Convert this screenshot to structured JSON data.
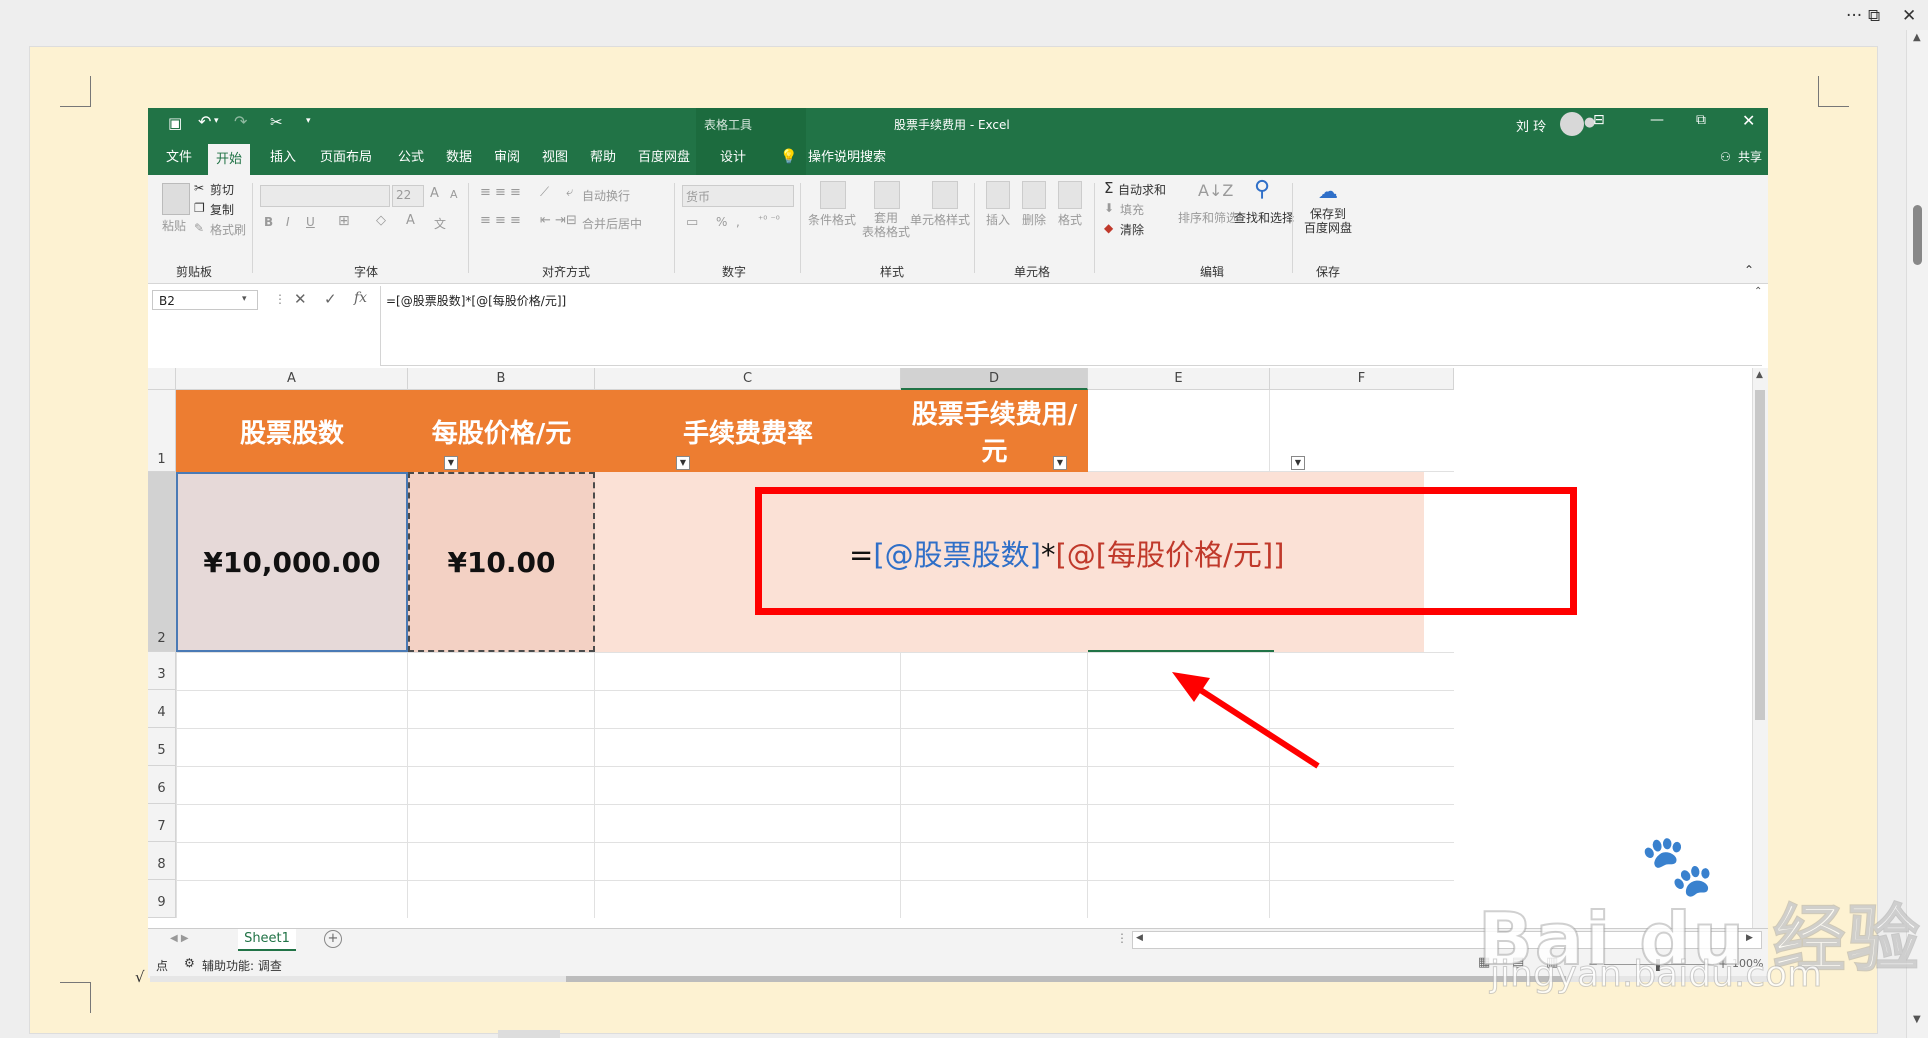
{
  "window_controls": {
    "more": "···",
    "restore": "⧉",
    "close": "✕"
  },
  "excel": {
    "qat": {
      "save_icon": "save-icon",
      "undo_icon": "undo-icon",
      "redo_icon": "redo-icon",
      "cut_icon": "scissors-icon",
      "customize": "▾"
    },
    "context_tab_group": "表格工具",
    "title": "股票手续费用 - Excel",
    "user": "刘 玲",
    "tabs": [
      "文件",
      "开始",
      "插入",
      "页面布局",
      "公式",
      "数据",
      "审阅",
      "视图",
      "帮助",
      "百度网盘",
      "设计"
    ],
    "active_tab": "开始",
    "tell_me": "操作说明搜索",
    "share": "共享",
    "ribbon": {
      "clipboard": {
        "paste": "粘贴",
        "cut": "剪切",
        "copy": "复制",
        "format_painter": "格式刷",
        "label": "剪贴板"
      },
      "font": {
        "size": "22",
        "bold": "B",
        "italic": "I",
        "underline": "U",
        "grow": "A",
        "shrink": "A",
        "font_color": "A",
        "phonetic": "文",
        "label": "字体"
      },
      "alignment": {
        "wrap": "自动换行",
        "merge": "合并后居中",
        "label": "对齐方式"
      },
      "number": {
        "format": "货币",
        "percent": "%",
        "comma": ",",
        "label": "数字"
      },
      "styles": {
        "conditional": "条件格式",
        "table_fmt": "套用\n表格格式",
        "cell_styles": "单元格样式",
        "label": "样式"
      },
      "cells": {
        "insert": "插入",
        "delete": "删除",
        "format": "格式",
        "label": "单元格"
      },
      "editing": {
        "autosum": "自动求和",
        "fill": "填充",
        "clear": "清除",
        "sort": "排序和筛选",
        "find": "查找和选择",
        "label": "编辑"
      },
      "save": {
        "save_to": "保存到\n百度网盘",
        "label": "保存"
      }
    },
    "name_box": "B2",
    "fx": "fx",
    "formula": "=[@股票股数]*[@[每股价格/元]]",
    "columns": [
      "A",
      "B",
      "C",
      "D",
      "E",
      "F"
    ],
    "rows": [
      "1",
      "2",
      "3",
      "4",
      "5",
      "6",
      "7",
      "8",
      "9"
    ],
    "headers": [
      "股票股数",
      "每股价格/元",
      "手续费费率",
      "股票手续费用/元"
    ],
    "row2": {
      "a": "¥10,000.00",
      "b": "¥10.00"
    },
    "formula_display": {
      "eq": "=",
      "part1": "[@股票股数]",
      "star": "*",
      "part2": "[@[每股价格/元]]"
    },
    "sheet_tab": "Sheet1",
    "status": {
      "mode": "点",
      "accessibility": "辅助功能: 调查",
      "zoom": "100%"
    }
  },
  "watermark": {
    "logo": "Bai du 经验",
    "url": "jingyan.baidu.com"
  },
  "colors": {
    "excel_green": "#217346",
    "header_orange": "#ed7d31",
    "highlight_red": "#ff0000",
    "ref_blue": "#2f6fc8",
    "ref_red": "#c0392b"
  }
}
